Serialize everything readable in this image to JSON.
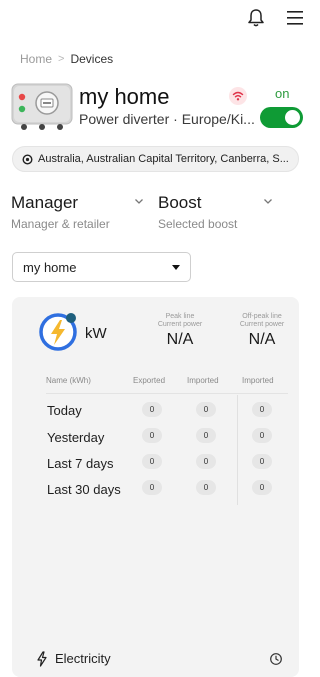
{
  "breadcrumb": {
    "home": "Home",
    "separator": ">",
    "current": "Devices"
  },
  "device": {
    "name": "my home",
    "subtitle": "Power diverter · Europe/Ki...",
    "status_label": "on",
    "toggle_on": true,
    "location": "Australia, Australian Capital Territory, Canberra, S..."
  },
  "selectors": [
    {
      "title": "Manager",
      "subtitle": "Manager & retailer"
    },
    {
      "title": "Boost",
      "subtitle": "Selected boost"
    }
  ],
  "dropdown": {
    "value": "my home"
  },
  "energy": {
    "unit": "kW",
    "peak": {
      "line1": "Peak line",
      "line2": "Current power",
      "value": "N/A"
    },
    "offpeak": {
      "line1": "Off-peak line",
      "line2": "Current power",
      "value": "N/A"
    },
    "headers": {
      "name": "Name (kWh)",
      "exported": "Exported",
      "imported": "Imported",
      "imported2": "Imported"
    },
    "rows": [
      {
        "label": "Today",
        "exported": "0",
        "imported": "0",
        "imported2": "0"
      },
      {
        "label": "Yesterday",
        "exported": "0",
        "imported": "0",
        "imported2": "0"
      },
      {
        "label": "Last 7 days",
        "exported": "0",
        "imported": "0",
        "imported2": "0"
      },
      {
        "label": "Last 30 days",
        "exported": "0",
        "imported": "0",
        "imported2": "0"
      }
    ],
    "footer_label": "Electricity"
  },
  "colors": {
    "accent_green": "#0f9b35",
    "energy_blue": "#2f6fe0",
    "energy_yellow": "#f5b82e",
    "wifi_red": "#e0344a"
  }
}
